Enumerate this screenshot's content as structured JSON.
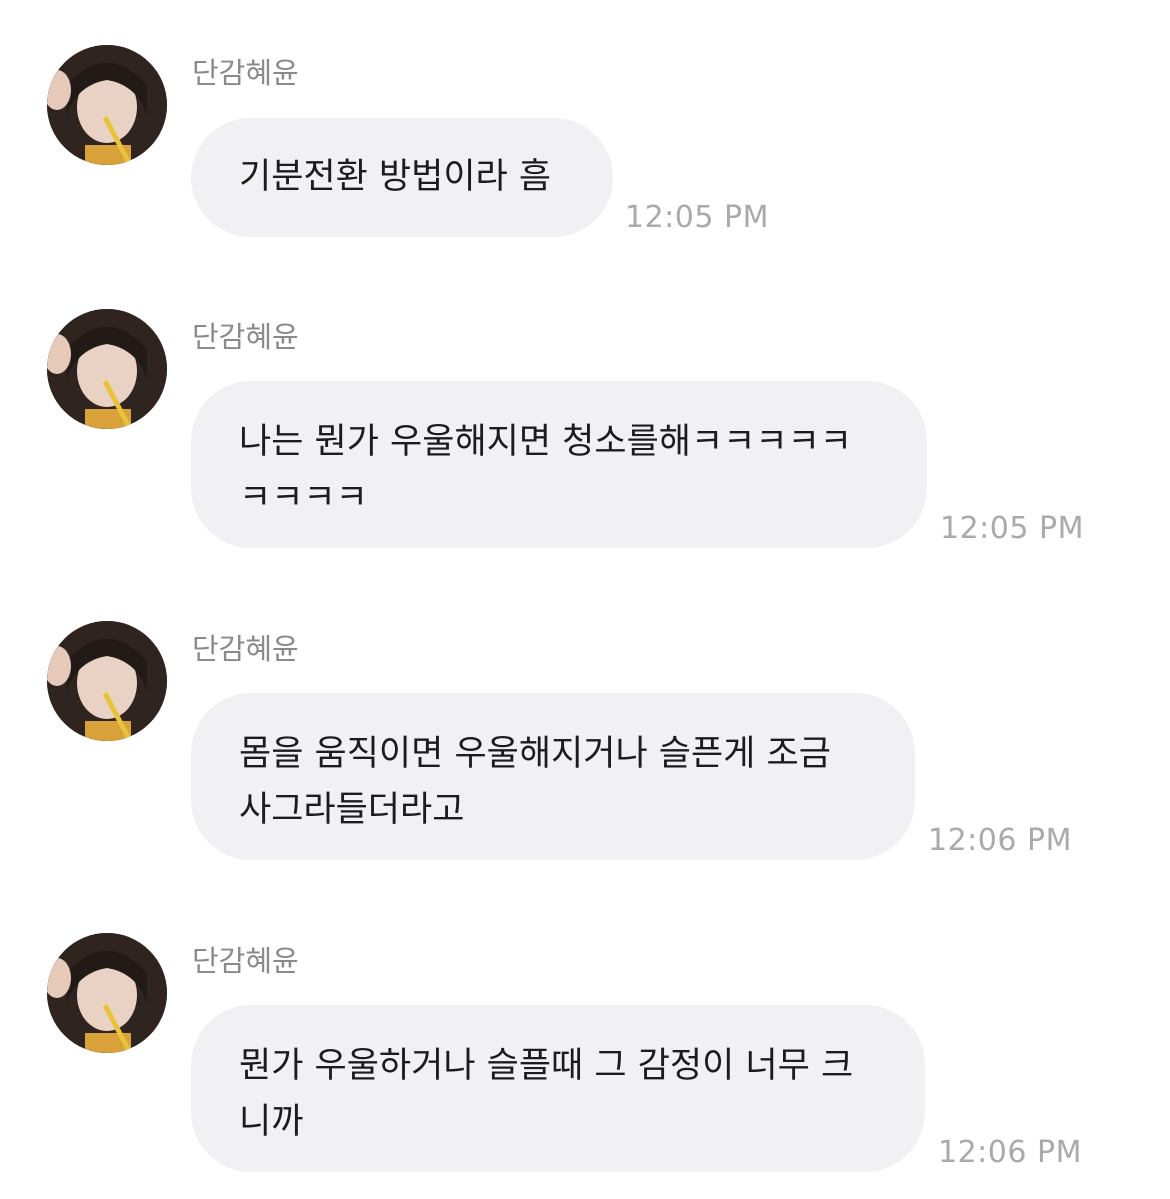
{
  "messages": [
    {
      "sender": "단감혜윤",
      "text": "기분전환 방법이라 흠",
      "time": "12:05 PM"
    },
    {
      "sender": "단감혜윤",
      "text": "나는 뭔가 우울해지면 청소를해ㅋㅋㅋㅋㅋ\nㅋㅋㅋㅋ",
      "time": "12:05 PM"
    },
    {
      "sender": "단감혜윤",
      "text": "몸을 움직이면 우울해지거나 슬픈게 조금\n사그라들더라고",
      "time": "12:06 PM"
    },
    {
      "sender": "단감혜윤",
      "text": "뭔가 우울하거나 슬플때 그 감정이 너무 크\n니까",
      "time": "12:06 PM"
    }
  ]
}
